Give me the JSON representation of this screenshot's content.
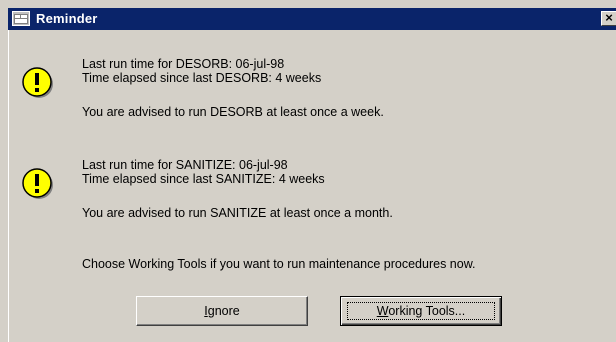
{
  "window": {
    "title": "Reminder",
    "close_glyph": "×"
  },
  "reminders": [
    {
      "icon": "exclamation-icon",
      "line1": "Last run time for DESORB: 06-jul-98",
      "line2": "Time elapsed since last DESORB: 4 weeks",
      "advice": "You are advised to run DESORB at least once a week."
    },
    {
      "icon": "exclamation-icon",
      "line1": "Last run time for SANITIZE: 06-jul-98",
      "line2": "Time elapsed since last SANITIZE: 4 weeks",
      "advice": "You are advised to run SANITIZE at least once a month."
    }
  ],
  "instruction": "Choose Working Tools if you want to run maintenance procedures now.",
  "buttons": {
    "ignore": {
      "mnemonic": "I",
      "rest": "gnore"
    },
    "working_tools": {
      "mnemonic": "W",
      "rest": "orking Tools..."
    }
  },
  "colors": {
    "titlebar": "#0a246a",
    "face": "#d4d0c8",
    "icon_yellow": "#ffff00"
  }
}
